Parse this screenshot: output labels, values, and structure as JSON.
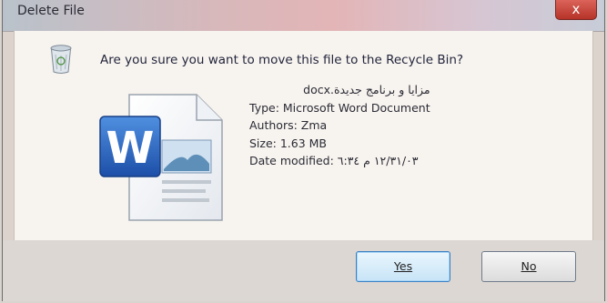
{
  "window": {
    "title": "Delete File",
    "close_glyph": "x"
  },
  "message": {
    "question": "Are you sure you want to move this file to the Recycle Bin?"
  },
  "file": {
    "name": "مزایا و برنامج جدیدة.docx",
    "type": "Type: Microsoft Word Document",
    "authors": "Authors: Zma",
    "size": "Size: 1.63 MB",
    "date_modified": "Date modified: ١٢/٣١/٠٣ م ٦:٣٤"
  },
  "icons": {
    "recycle": "recycle-bin-icon",
    "document": "word-document-icon"
  },
  "buttons": {
    "yes_label": "Yes",
    "no_label": "No"
  },
  "colors": {
    "title_bar": "#d7b8bb",
    "content_bg": "#f7f3ef",
    "button_bar": "#dcd7d3",
    "close_red": "#c6433a",
    "default_button_border": "#3b7fc4"
  }
}
